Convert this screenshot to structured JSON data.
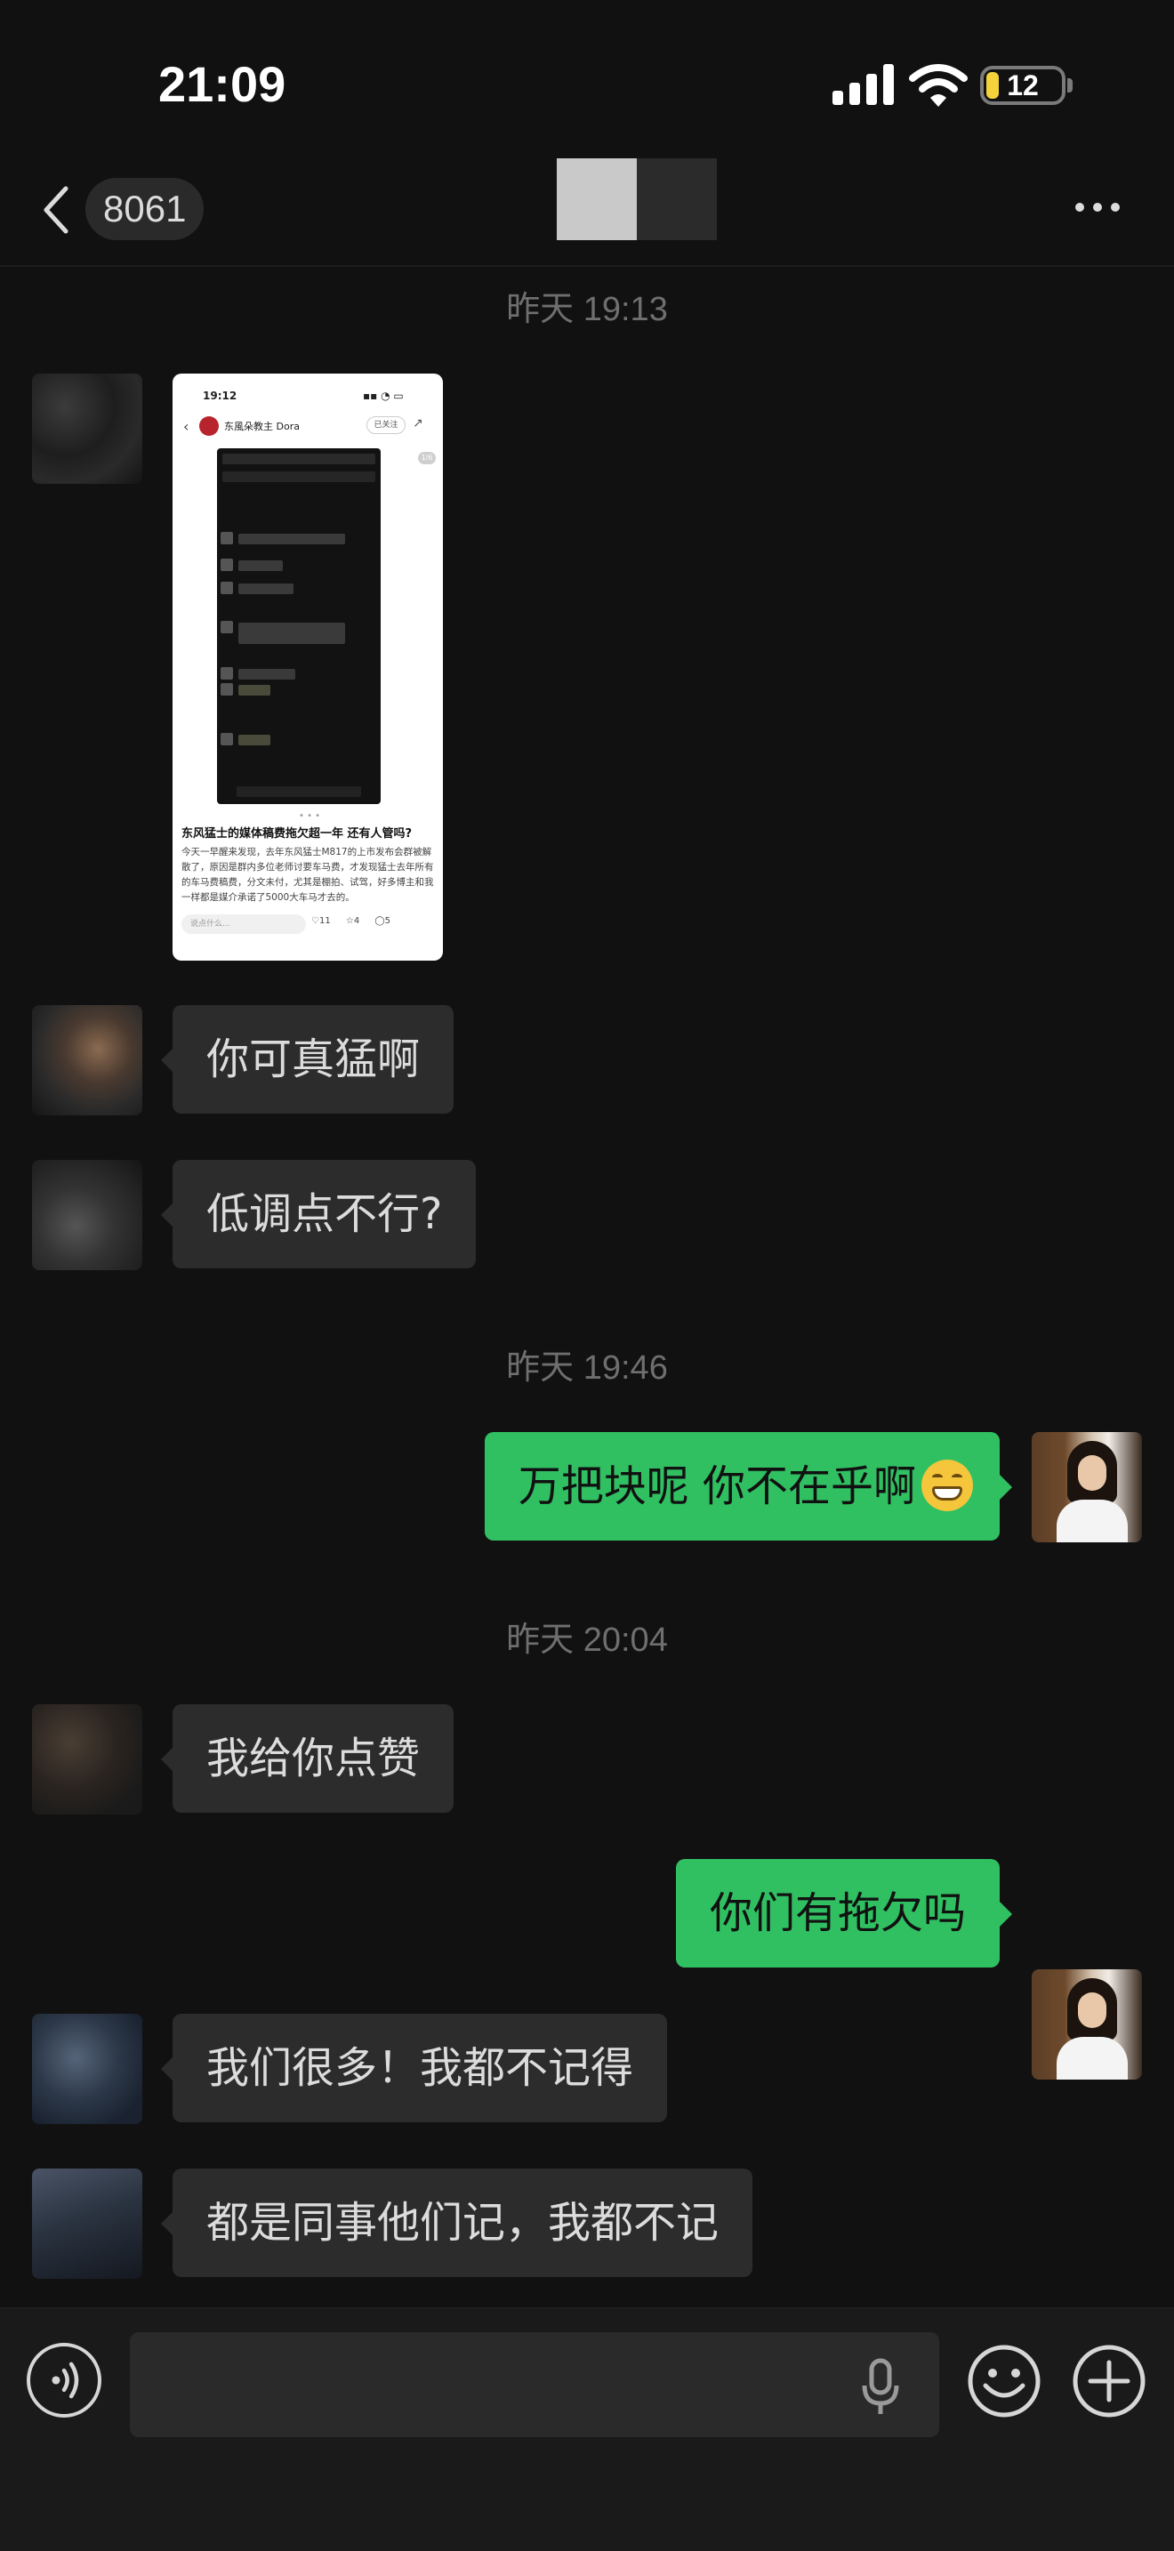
{
  "status": {
    "time": "21:09",
    "battery": "12",
    "signal_icon": "signal-bars-icon",
    "wifi_icon": "wifi-icon"
  },
  "nav": {
    "back_icon": "chevron-left-icon",
    "unread_count": "8061",
    "more_icon": "ellipsis-icon"
  },
  "timestamps": [
    "昨天 19:13",
    "昨天 19:46",
    "昨天 20:04"
  ],
  "image_message": {
    "time": "19:12",
    "author": "东風朵教主 Dora",
    "follow_label": "已关注",
    "page_indicator": "1/6",
    "headline": "东风猛士的媒体稿费拖欠超一年 还有人管吗?",
    "body": "今天一早醒来发现，去年东风猛士M817的上市发布会群被解散了，原因是群内多位老师讨要车马费，才发现猛士去年所有的车马费稿费，分文未付，尤其是棚拍、试驾，好多博主和我一样都是媒介承诺了5000大车马才去的。",
    "comment_placeholder": "说点什么...",
    "likes": "11",
    "favorites": "4",
    "comments": "5"
  },
  "messages": [
    {
      "side": "in",
      "text": "你可真猛啊"
    },
    {
      "side": "in",
      "text": "低调点不行?"
    },
    {
      "side": "out",
      "text": "万把块呢 你不在乎啊"
    },
    {
      "side": "in",
      "text": "我给你点赞"
    },
    {
      "side": "out",
      "text": "你们有拖欠吗"
    },
    {
      "side": "in",
      "text": "我们很多！我都不记得"
    },
    {
      "side": "in",
      "text": "都是同事他们记，我都不记"
    }
  ],
  "input_bar": {
    "voice_icon": "voice-mode-icon",
    "mic_icon": "microphone-icon",
    "emoji_icon": "emoji-smile-icon",
    "plus_icon": "plus-circle-icon",
    "input_value": ""
  },
  "colors": {
    "background": "#111111",
    "incoming_bubble": "#2c2c2c",
    "outgoing_bubble": "#30c062",
    "timestamp": "#6f6f6f"
  }
}
